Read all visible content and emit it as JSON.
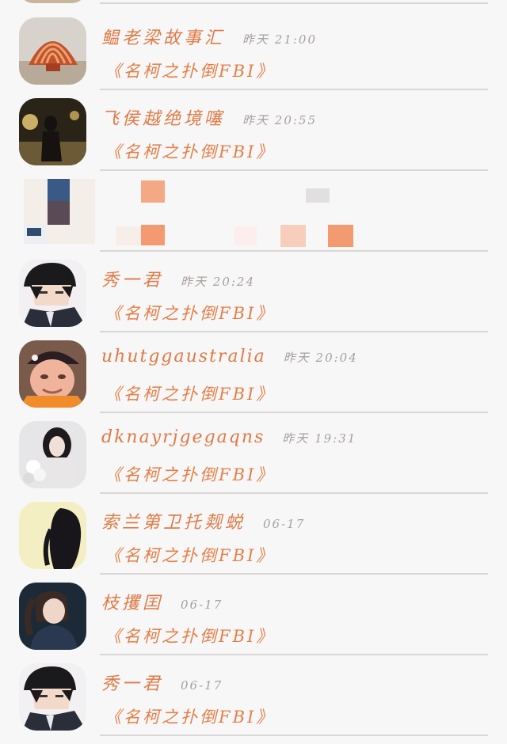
{
  "messages": [
    {
      "name": "鳁老梁故事汇",
      "time": "昨天 21:00",
      "preview": "《名柯之扑倒FBI》",
      "avatar_icon": "shell-avatar-icon"
    },
    {
      "name": "飞侯越绝境噻",
      "time": "昨天 20:55",
      "preview": "《名柯之扑倒FBI》",
      "avatar_icon": "night-figure-avatar-icon"
    },
    {
      "name": "秀一君",
      "time": "昨天 20:24",
      "preview": "《名柯之扑倒FBI》",
      "avatar_icon": "beanie-anime-avatar-icon"
    },
    {
      "name": "uhutggaustralia",
      "time": "昨天 20:04",
      "preview": "《名柯之扑倒FBI》",
      "avatar_icon": "masked-face-avatar-icon"
    },
    {
      "name": "dknayrjgegaqns",
      "time": "昨天 19:31",
      "preview": "《名柯之扑倒FBI》",
      "avatar_icon": "girl-flowers-avatar-icon"
    },
    {
      "name": "索兰第卫托觌蜕",
      "time": "06-17",
      "preview": "《名柯之扑倒FBI》",
      "avatar_icon": "dark-hair-avatar-icon"
    },
    {
      "name": "枝攫囯",
      "time": "06-17",
      "preview": "《名柯之扑倒FBI》",
      "avatar_icon": "ponytail-girl-avatar-icon"
    },
    {
      "name": "秀一君",
      "time": "06-17",
      "preview": "《名柯之扑倒FBI》",
      "avatar_icon": "beanie-anime-avatar-icon"
    }
  ],
  "colors": {
    "accent": "#e07a45",
    "time": "#a59f9c",
    "divider": "#d9d6d6",
    "background": "#f8f7f8"
  }
}
